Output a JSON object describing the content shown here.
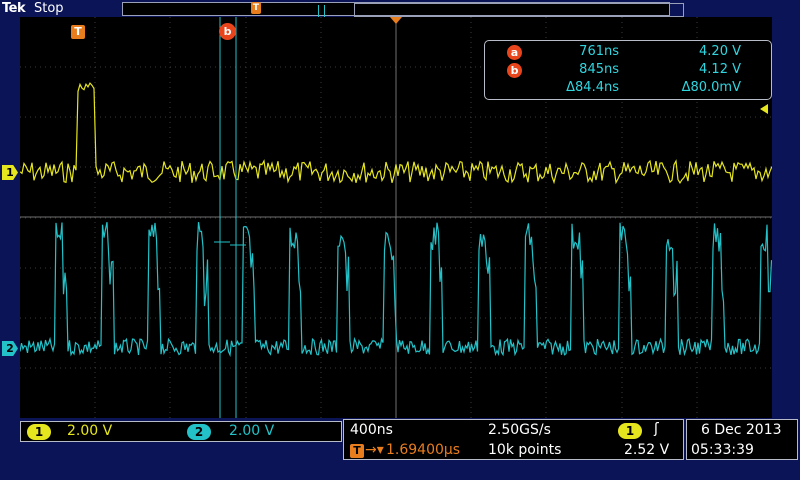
{
  "brand": "Tek",
  "run_state": "Stop",
  "markers": {
    "trigger_label": "T",
    "cursor_a": "a",
    "cursor_b": "b"
  },
  "readout": {
    "cursor_a": {
      "label": "a",
      "time": "761ns",
      "voltage": "4.20 V"
    },
    "cursor_b": {
      "label": "b",
      "time": "845ns",
      "voltage": "4.12 V"
    },
    "delta": {
      "time": "Δ84.4ns",
      "voltage": "Δ80.0mV"
    }
  },
  "channels": [
    {
      "label": "1",
      "scale": "2.00 V",
      "color": "#e6e61e"
    },
    {
      "label": "2",
      "scale": "2.00 V",
      "color": "#23c2c9"
    }
  ],
  "horizontal": {
    "time_per_div": "400ns",
    "sample_rate": "2.50GS/s",
    "trigger_position": "1.69400µs",
    "record_length": "10k points"
  },
  "trigger": {
    "source": "1",
    "slope_icon": "rising-edge-icon",
    "level": "2.52 V"
  },
  "datetime": {
    "date": "6 Dec 2013",
    "time": "05:33:39"
  },
  "colors": {
    "ch1": "#e6e61e",
    "ch2": "#23c2c9",
    "trigger": "#e87d1e",
    "cursor": "#e8451d",
    "background": "#0b1457"
  }
}
